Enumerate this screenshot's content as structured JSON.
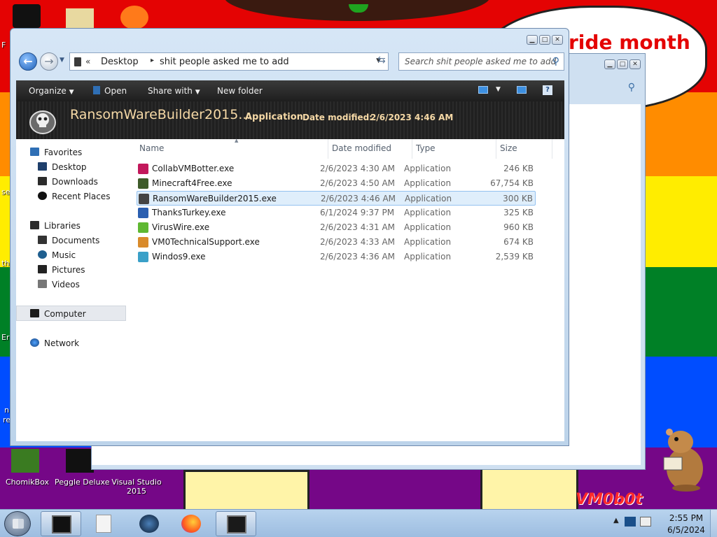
{
  "wallpaper": {
    "headline": "ride month",
    "logo": "VM0b0t",
    "edge_glyphs": [
      "F",
      "se",
      "th",
      "Er",
      "n",
      "re"
    ]
  },
  "desktop_icons": [
    {
      "label": "ChomikBox"
    },
    {
      "label": "Peggle Deluxe"
    },
    {
      "label": "Visual Studio 2015"
    }
  ],
  "window": {
    "address": {
      "overflow_chevron": "«",
      "segments": [
        "Desktop",
        "shit people asked me to add"
      ],
      "separator": "▸"
    },
    "search": {
      "placeholder": "Search shit people asked me to add"
    },
    "toolbar": {
      "organize": "Organize",
      "open": "Open",
      "share_with": "Share with",
      "new_folder": "New folder"
    },
    "details": {
      "name": "RansomWareBuilder2015...",
      "type": "Application",
      "date_modified_label": "Date modified:",
      "date_modified_value": "2/6/2023 4:46 AM"
    },
    "nav": {
      "favorites": "Favorites",
      "desktop": "Desktop",
      "downloads": "Downloads",
      "recent": "Recent Places",
      "libraries": "Libraries",
      "documents": "Documents",
      "music": "Music",
      "pictures": "Pictures",
      "videos": "Videos",
      "computer": "Computer",
      "network": "Network"
    },
    "columns": {
      "name": "Name",
      "date": "Date modified",
      "type": "Type",
      "size": "Size"
    },
    "files": [
      {
        "name": "CollabVMBotter.exe",
        "date": "2/6/2023 4:30 AM",
        "type": "Application",
        "size": "246 KB",
        "icon": "collab-icon",
        "color": "#c2185b"
      },
      {
        "name": "Minecraft4Free.exe",
        "date": "2/6/2023 4:50 AM",
        "type": "Application",
        "size": "67,754 KB",
        "icon": "minecraft-icon",
        "color": "#3e5b2a"
      },
      {
        "name": "RansomWareBuilder2015.exe",
        "date": "2/6/2023 4:46 AM",
        "type": "Application",
        "size": "300 KB",
        "icon": "skull-icon",
        "color": "#444444"
      },
      {
        "name": "ThanksTurkey.exe",
        "date": "6/1/2024 9:37 PM",
        "type": "Application",
        "size": "325 KB",
        "icon": "turkey-icon",
        "color": "#2b5fb0"
      },
      {
        "name": "VirusWire.exe",
        "date": "2/6/2023 4:31 AM",
        "type": "Application",
        "size": "960 KB",
        "icon": "viruswire-icon",
        "color": "#5fb832"
      },
      {
        "name": "VM0TechnicalSupport.exe",
        "date": "2/6/2023 4:33 AM",
        "type": "Application",
        "size": "674 KB",
        "icon": "support-icon",
        "color": "#d98b2b"
      },
      {
        "name": "Windos9.exe",
        "date": "2/6/2023 4:36 AM",
        "type": "Application",
        "size": "2,539 KB",
        "icon": "windos-icon",
        "color": "#3aa0c8"
      }
    ],
    "selected_index": 2
  },
  "taskbar": {
    "clock_time": "2:55 PM",
    "clock_date": "6/5/2024"
  }
}
